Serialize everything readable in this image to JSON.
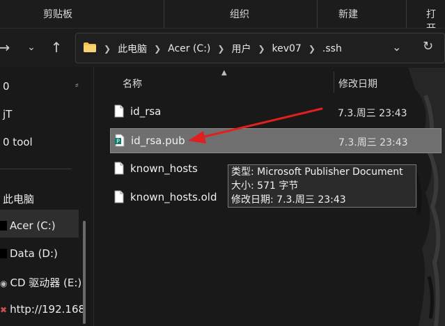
{
  "ribbon": {
    "groups": [
      "剪贴板",
      "组织",
      "新建",
      "打开"
    ]
  },
  "nav": {
    "back_icon": "back-arrow-icon",
    "forward_icon": "chevron-down-icon",
    "up_icon": "up-arrow-icon",
    "breadcrumbs": [
      "此电脑",
      "Acer (C:)",
      "用户",
      "kev07",
      ".ssh"
    ]
  },
  "sidebar": {
    "items": [
      {
        "label": "0"
      },
      {
        "label": "jT"
      },
      {
        "label": "0 tool"
      },
      {
        "label": "此电脑"
      },
      {
        "label": "Acer (C:)"
      },
      {
        "label": "Data (D:)"
      },
      {
        "label": "CD 驱动器 (E:)"
      },
      {
        "label": "http://192.168"
      }
    ]
  },
  "columns": {
    "name": "名称",
    "modified": "修改日期"
  },
  "files": [
    {
      "name": "id_rsa",
      "date": "7.3.周三 23:43",
      "icon": "file-icon"
    },
    {
      "name": "id_rsa.pub",
      "date": "7.3.周三 23:43",
      "icon": "publisher-file-icon",
      "selected": true
    },
    {
      "name": "known_hosts",
      "date": "",
      "icon": "file-icon"
    },
    {
      "name": "known_hosts.old",
      "date": "",
      "icon": "file-icon"
    }
  ],
  "tooltip": {
    "type": "类型: Microsoft Publisher Document",
    "size": "大小: 571 字节",
    "modified": "修改日期: 7.3.周三 23:43"
  },
  "colors": {
    "background": "#191919",
    "selection": "#6f6f6f",
    "annotation_arrow": "#e02020",
    "folder": "#f2c14e",
    "publisher": "#0f7b6c"
  }
}
